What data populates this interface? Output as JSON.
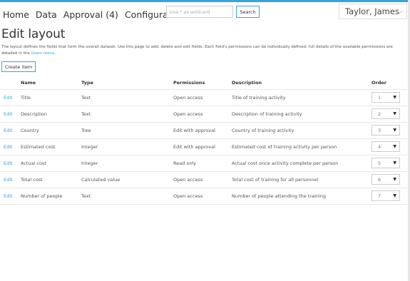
{
  "nav": {
    "home": "Home",
    "data": "Data",
    "approval": "Approval (4)",
    "configuration": "Configuration"
  },
  "search": {
    "placeholder": "Use * as wildcard",
    "button": "Search"
  },
  "user": {
    "name": "Taylor, James"
  },
  "page": {
    "title": "Edit layout",
    "description": "The layout defines the fields that form the overall dataset. Use this page to add, delete and edit fields. Each field's permissions can be individually defined; full details of the available permissions are detailed in the ",
    "link_text": "Users menu",
    "description_end": ".",
    "create_button": "Create item"
  },
  "table": {
    "headers": {
      "name": "Name",
      "type": "Type",
      "permissions": "Permissions",
      "description": "Description",
      "order": "Order"
    },
    "edit_label": "Edit",
    "rows": [
      {
        "name": "Title",
        "type": "Text",
        "permissions": "Open access",
        "description": "Title of training activity",
        "order": "1"
      },
      {
        "name": "Description",
        "type": "Text",
        "permissions": "Open access",
        "description": "Description of training activity",
        "order": "2"
      },
      {
        "name": "Country",
        "type": "Tree",
        "permissions": "Edit with approval",
        "description": "Country of training activity",
        "order": "3"
      },
      {
        "name": "Estimated cost",
        "type": "Integer",
        "permissions": "Edit with approval",
        "description": "Estimated cost of training activity per person",
        "order": "4"
      },
      {
        "name": "Actual cost",
        "type": "Integer",
        "permissions": "Read only",
        "description": "Actual cost once activity complete per person",
        "order": "5"
      },
      {
        "name": "Total cost",
        "type": "Calculated value",
        "permissions": "Open access",
        "description": "Total cost of training for all personnel",
        "order": "6"
      },
      {
        "name": "Number of people",
        "type": "Text",
        "permissions": "Open access",
        "description": "Number of people attending the training",
        "order": "7"
      }
    ]
  },
  "colors": {
    "accent": "#3aa3d8",
    "border": "#cccccc",
    "text": "#333333"
  }
}
